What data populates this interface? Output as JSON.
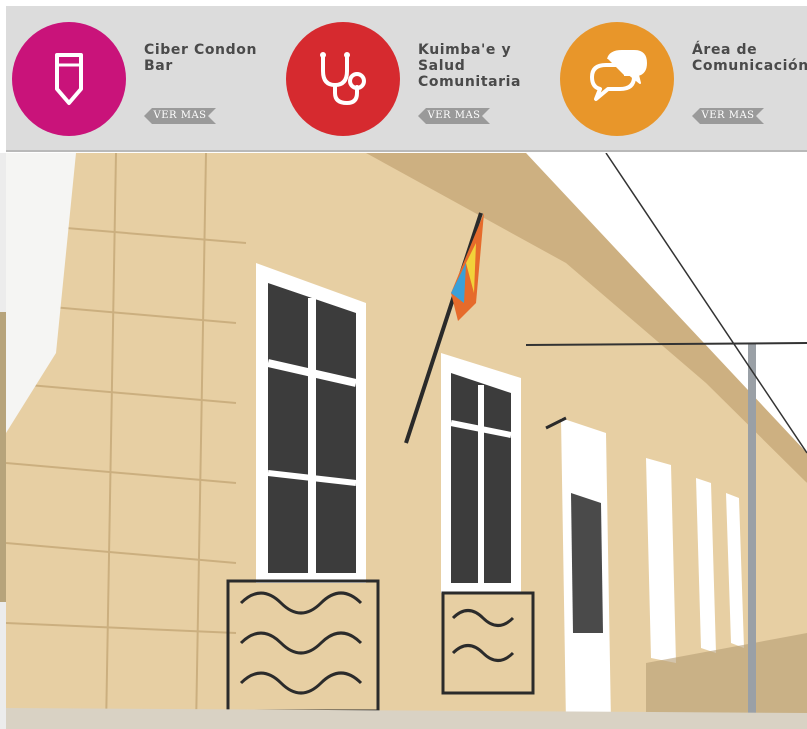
{
  "cards": [
    {
      "title": "Ciber Condon\nBar",
      "cta": "VER MAS",
      "color": "#c9137a",
      "icon": "ticket-icon"
    },
    {
      "title": "Kuimba'e y\nSalud\nComunitaria",
      "cta": "VER MAS",
      "color": "#d62a2f",
      "icon": "stethoscope-icon"
    },
    {
      "title": "Área de\nComunicación",
      "cta": "VER MAS",
      "color": "#e8962a",
      "icon": "chat-bubbles-icon"
    }
  ],
  "photo": {
    "subject": "building-facade",
    "colors": {
      "wall": "#e7cfa3",
      "wall_shadow": "#d6b887",
      "window_frame": "#ffffff",
      "iron": "#2b2b2b",
      "sky": "#ffffff"
    }
  }
}
